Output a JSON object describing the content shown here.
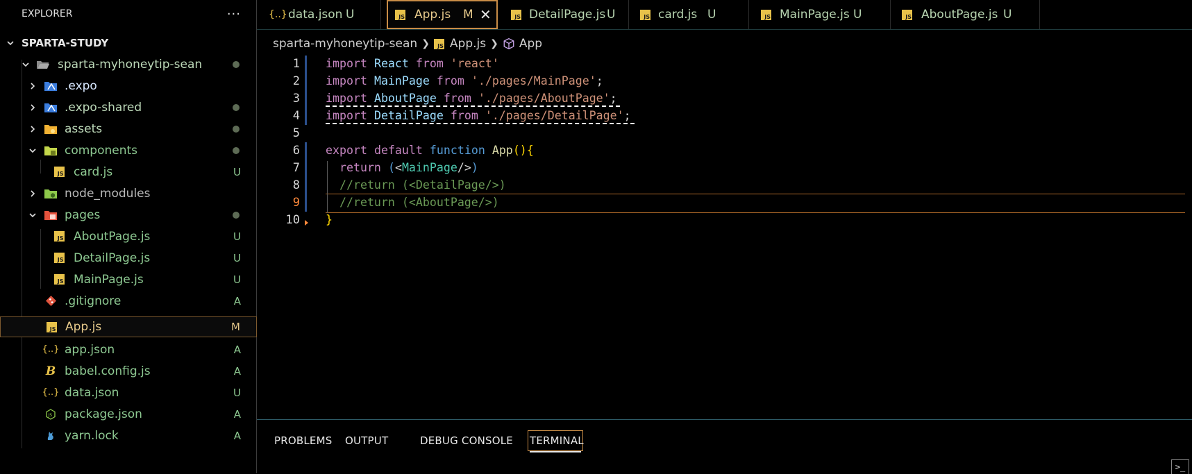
{
  "explorer": {
    "title": "EXPLORER",
    "more": "···",
    "workspace": "SPARTA-STUDY",
    "tree": [
      {
        "label": "sparta-myhoneytip-sean",
        "status": ""
      },
      {
        "label": ".expo",
        "status": ""
      },
      {
        "label": ".expo-shared",
        "status": ""
      },
      {
        "label": "assets",
        "status": ""
      },
      {
        "label": "components",
        "status": ""
      },
      {
        "label": "card.js",
        "status": "U"
      },
      {
        "label": "node_modules",
        "status": ""
      },
      {
        "label": "pages",
        "status": ""
      },
      {
        "label": "AboutPage.js",
        "status": "U"
      },
      {
        "label": "DetailPage.js",
        "status": "U"
      },
      {
        "label": "MainPage.js",
        "status": "U"
      },
      {
        "label": ".gitignore",
        "status": "A"
      },
      {
        "label": "App.js",
        "status": "M"
      },
      {
        "label": "app.json",
        "status": "A"
      },
      {
        "label": "babel.config.js",
        "status": "A"
      },
      {
        "label": "data.json",
        "status": "U"
      },
      {
        "label": "package.json",
        "status": "A"
      },
      {
        "label": "yarn.lock",
        "status": "A"
      }
    ]
  },
  "tabs": [
    {
      "icon": "{..}",
      "label": "data.json",
      "status": "U"
    },
    {
      "icon": "JS",
      "label": "App.js",
      "status": "M",
      "close": "✕"
    },
    {
      "icon": "JS",
      "label": "DetailPage.js",
      "status": "U"
    },
    {
      "icon": "JS",
      "label": "card.js",
      "status": "U"
    },
    {
      "icon": "JS",
      "label": "MainPage.js",
      "status": "U"
    },
    {
      "icon": "JS",
      "label": "AboutPage.js",
      "status": "U"
    }
  ],
  "breadcrumb": {
    "folder": "sparta-myhoneytip-sean",
    "file": "App.js",
    "symbol": "App"
  },
  "editor": {
    "line_numbers": [
      "1",
      "2",
      "3",
      "4",
      "5",
      "6",
      "7",
      "8",
      "9",
      "10"
    ],
    "current_line": 9,
    "lines": [
      [
        [
          "kw",
          "import"
        ],
        [
          "pun",
          " "
        ],
        [
          "id",
          "React"
        ],
        [
          "pun",
          " "
        ],
        [
          "kw",
          "from"
        ],
        [
          "pun",
          " "
        ],
        [
          "str",
          "'react'"
        ]
      ],
      [
        [
          "kw",
          "import"
        ],
        [
          "pun",
          " "
        ],
        [
          "id",
          "MainPage"
        ],
        [
          "pun",
          " "
        ],
        [
          "kw",
          "from"
        ],
        [
          "pun",
          " "
        ],
        [
          "str",
          "'./pages/MainPage'"
        ],
        [
          "pun",
          ";"
        ]
      ],
      [
        [
          "kw",
          "import"
        ],
        [
          "pun",
          " "
        ],
        [
          "id",
          "AboutPage"
        ],
        [
          "pun",
          " "
        ],
        [
          "kw",
          "from"
        ],
        [
          "pun",
          " "
        ],
        [
          "str",
          "'./pages/AboutPage'"
        ],
        [
          "pun",
          ";"
        ]
      ],
      [
        [
          "kw",
          "import"
        ],
        [
          "pun",
          " "
        ],
        [
          "id",
          "DetailPage"
        ],
        [
          "pun",
          " "
        ],
        [
          "kw",
          "from"
        ],
        [
          "pun",
          " "
        ],
        [
          "str",
          "'./pages/DetailPage'"
        ],
        [
          "pun",
          ";"
        ]
      ],
      [],
      [
        [
          "kw",
          "export"
        ],
        [
          "pun",
          " "
        ],
        [
          "kw",
          "default"
        ],
        [
          "pun",
          " "
        ],
        [
          "kw2",
          "function"
        ],
        [
          "pun",
          " "
        ],
        [
          "fn",
          "App"
        ],
        [
          "brace",
          "(){"
        ]
      ],
      [
        [
          "pun",
          "  "
        ],
        [
          "kw",
          "return"
        ],
        [
          "pun",
          " "
        ],
        [
          "kw2",
          "("
        ],
        [
          "pun",
          "<"
        ],
        [
          "tag",
          "MainPage"
        ],
        [
          "pun",
          "/>"
        ],
        [
          "kw2",
          ")"
        ]
      ],
      [
        [
          "pun",
          "  "
        ],
        [
          "cmt",
          "//return (<DetailPage/>)"
        ]
      ],
      [
        [
          "pun",
          "  "
        ],
        [
          "cmt",
          "//return (<AboutPage/>)"
        ]
      ],
      [
        [
          "brace",
          "}"
        ]
      ]
    ]
  },
  "panel": {
    "tabs": [
      "PROBLEMS",
      "OUTPUT",
      "DEBUG CONSOLE",
      "TERMINAL"
    ],
    "active": "TERMINAL"
  },
  "colors": {
    "folder_green": "#8dc891",
    "accent_orange": "#c98d47",
    "js_yellow": "#e8c24a"
  }
}
